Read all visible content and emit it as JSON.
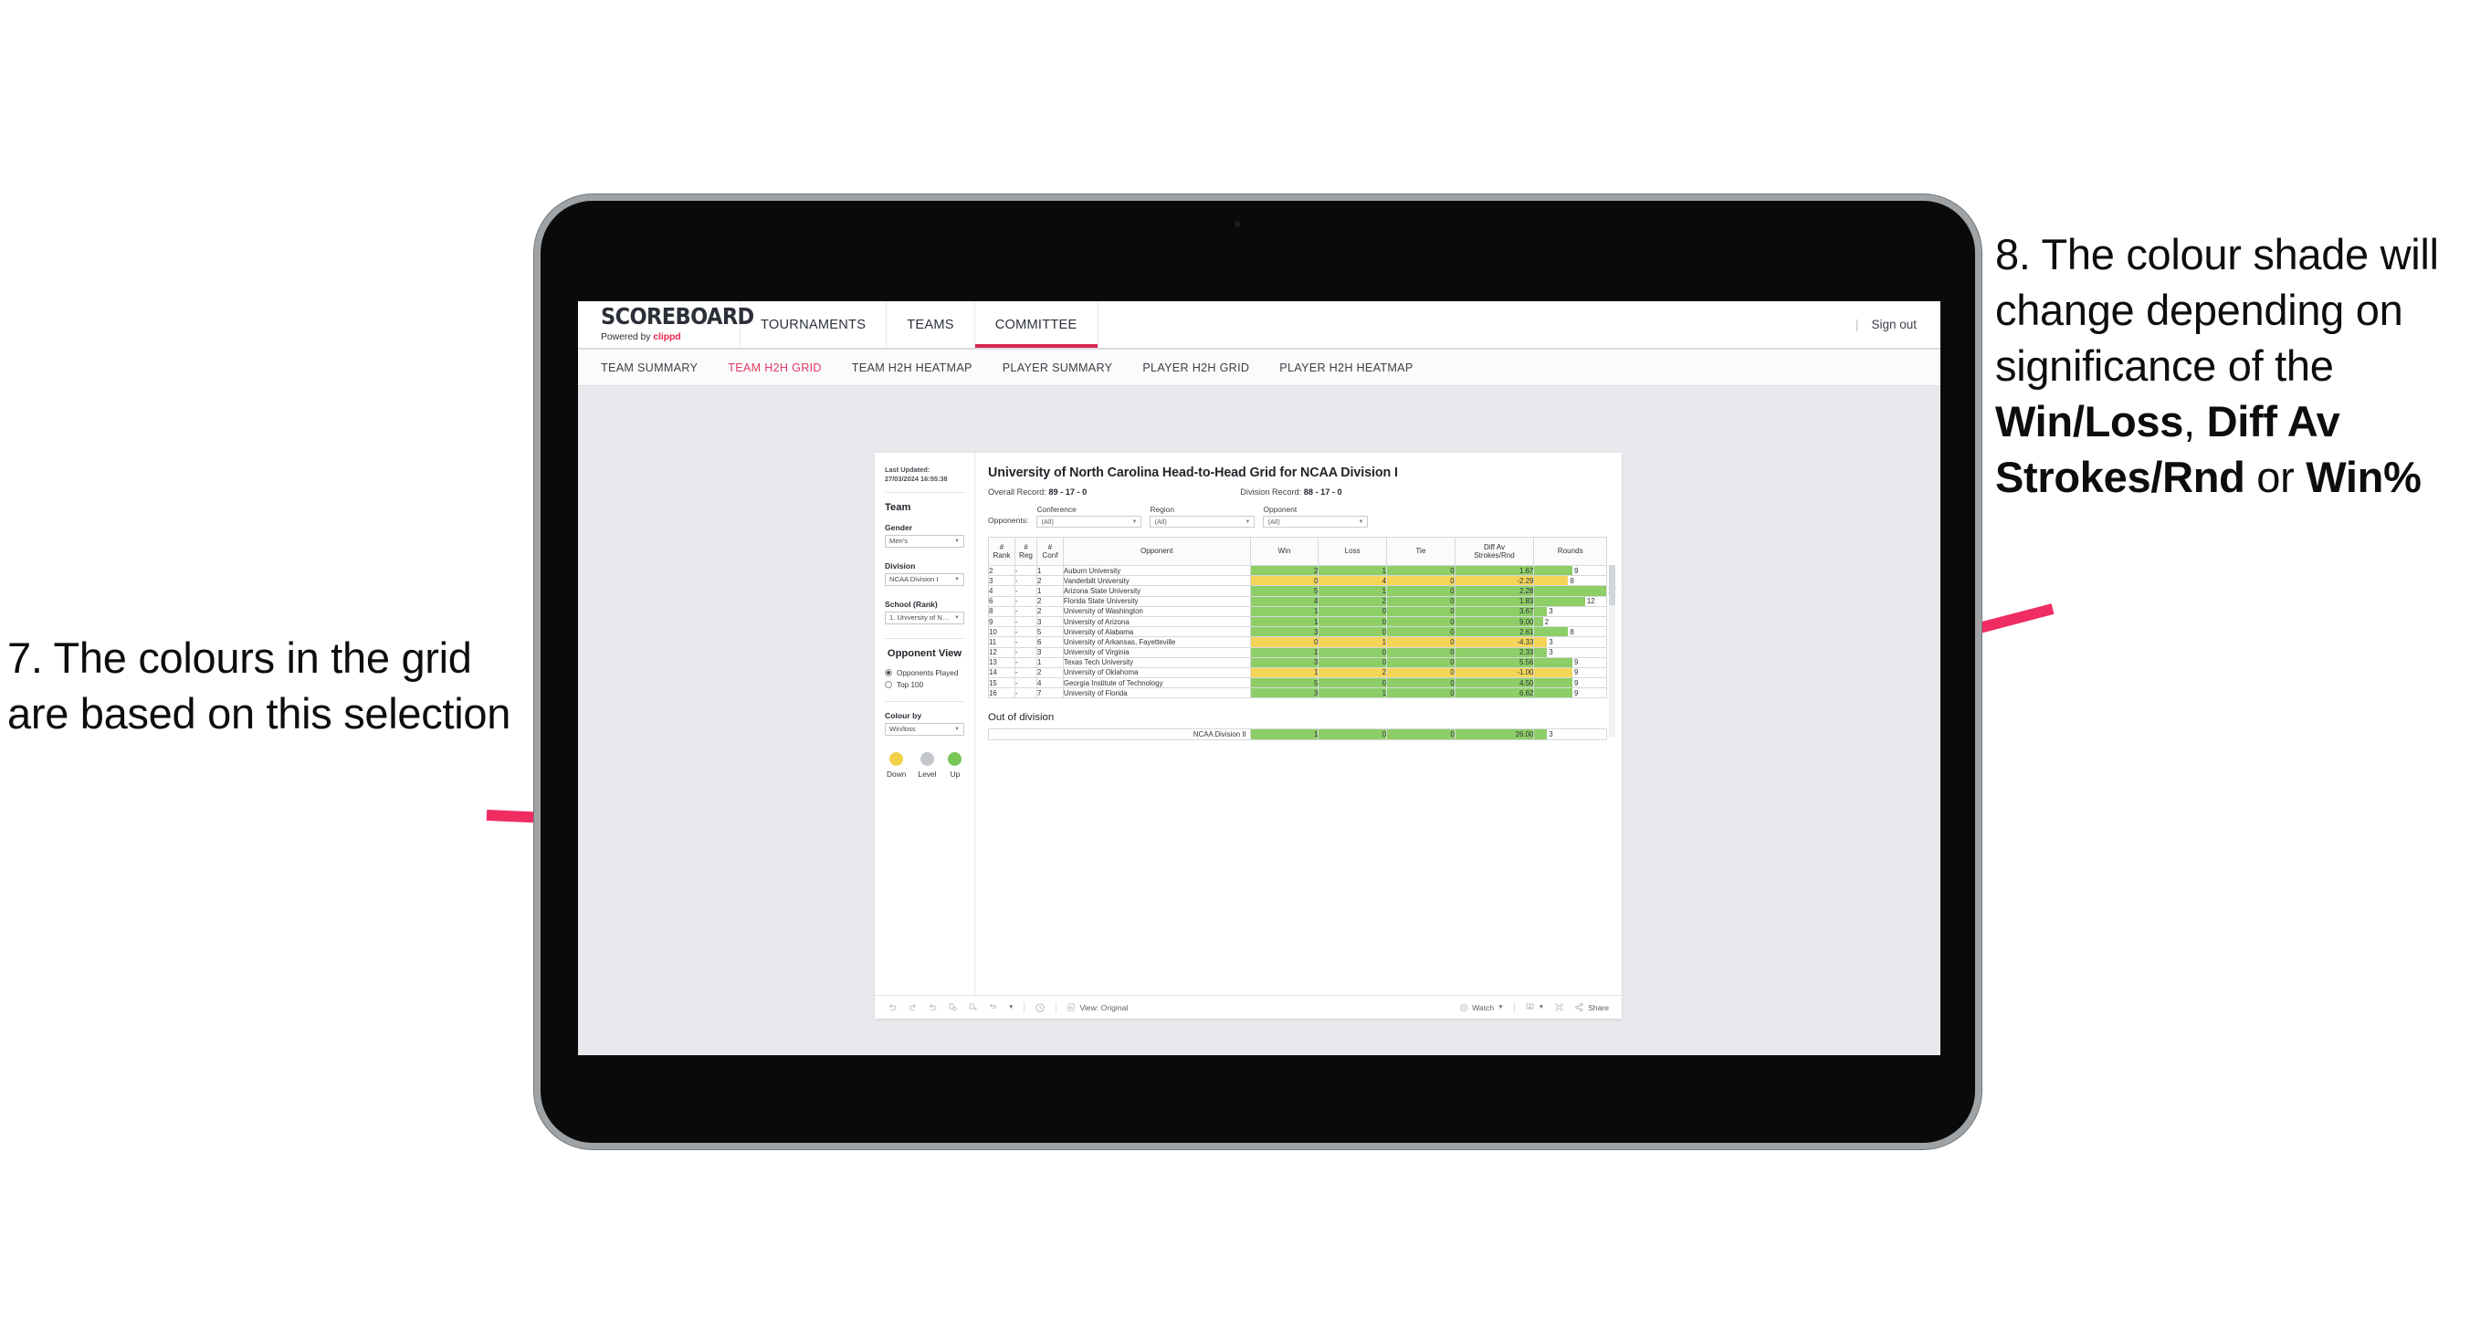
{
  "annotations": {
    "left": {
      "id": "7.",
      "text": "7. The colours in the grid are based on this selection"
    },
    "right": {
      "pre": "8. The colour shade will change depending on significance of the ",
      "b1": "Win/Loss",
      "mid1": ", ",
      "b2": "Diff Av Strokes/Rnd",
      "mid2": " or ",
      "b3": "Win%"
    },
    "arrow_color": "#ef2d62"
  },
  "app": {
    "brand": {
      "name": "SCOREBOARD",
      "powered_prefix": "Powered by ",
      "powered_brand": "clippd"
    },
    "topnav": [
      {
        "label": "TOURNAMENTS",
        "active": false
      },
      {
        "label": "TEAMS",
        "active": false
      },
      {
        "label": "COMMITTEE",
        "active": true
      }
    ],
    "signout": {
      "divider": "|",
      "label": "Sign out"
    },
    "subnav": [
      {
        "label": "TEAM SUMMARY",
        "active": false
      },
      {
        "label": "TEAM H2H GRID",
        "active": true
      },
      {
        "label": "TEAM H2H HEATMAP",
        "active": false
      },
      {
        "label": "PLAYER SUMMARY",
        "active": false
      },
      {
        "label": "PLAYER H2H GRID",
        "active": false
      },
      {
        "label": "PLAYER H2H HEATMAP",
        "active": false
      }
    ]
  },
  "panel": {
    "last_updated": "Last Updated: 27/03/2024 16:55:38",
    "team_heading": "Team",
    "gender": {
      "label": "Gender",
      "value": "Men's"
    },
    "division": {
      "label": "Division",
      "value": "NCAA Division I"
    },
    "school": {
      "label": "School (Rank)",
      "value": "1. University of Nort..."
    },
    "opponent_view": {
      "heading": "Opponent View",
      "options": [
        {
          "label": "Opponents Played",
          "selected": true
        },
        {
          "label": "Top 100",
          "selected": false
        }
      ]
    },
    "colour_by": {
      "label": "Colour by",
      "value": "Win/loss"
    },
    "legend": [
      {
        "label": "Down",
        "color": "#f2d24b"
      },
      {
        "label": "Level",
        "color": "#c3c6cb"
      },
      {
        "label": "Up",
        "color": "#77c657"
      }
    ]
  },
  "viz": {
    "title": "University of North Carolina Head-to-Head Grid for NCAA Division I",
    "overall_record": {
      "label": "Overall Record: ",
      "value": "89 - 17 - 0"
    },
    "division_record": {
      "label": "Division Record: ",
      "value": "88 - 17 - 0"
    },
    "opponents_label": "Opponents:",
    "filters": [
      {
        "label": "Conference",
        "value": "(All)"
      },
      {
        "label": "Region",
        "value": "(All)"
      },
      {
        "label": "Opponent",
        "value": "(All)"
      }
    ],
    "out_of_division_title": "Out of division"
  },
  "chart_data": {
    "type": "table",
    "title": "University of North Carolina Head-to-Head Grid for NCAA Division I",
    "columns": [
      "# Rank",
      "# Reg",
      "# Conf",
      "Opponent",
      "Win",
      "Loss",
      "Tie",
      "Diff Av Strokes/Rnd",
      "Rounds"
    ],
    "header_lines": [
      [
        "#",
        "Rank"
      ],
      [
        "#",
        "Reg"
      ],
      [
        "#",
        "Conf"
      ],
      [
        "Opponent"
      ],
      [
        "Win"
      ],
      [
        "Loss"
      ],
      [
        "Tie"
      ],
      [
        "Diff Av",
        "Strokes/Rnd"
      ],
      [
        "Rounds"
      ]
    ],
    "rounds_max": 17,
    "colors": {
      "up": "#8dce66",
      "down": "#f5d558"
    },
    "rows": [
      {
        "rank": "2",
        "reg": "-",
        "conf": "1",
        "opponent": "Auburn University",
        "win": "2",
        "loss": "1",
        "tie": "0",
        "diff": "1.67",
        "rounds": 9,
        "state": "up"
      },
      {
        "rank": "3",
        "reg": "-",
        "conf": "2",
        "opponent": "Vanderbilt University",
        "win": "0",
        "loss": "4",
        "tie": "0",
        "diff": "-2.29",
        "rounds": 8,
        "state": "down"
      },
      {
        "rank": "4",
        "reg": "-",
        "conf": "1",
        "opponent": "Arizona State University",
        "win": "5",
        "loss": "1",
        "tie": "0",
        "diff": "2.28",
        "rounds": 17,
        "state": "up"
      },
      {
        "rank": "6",
        "reg": "-",
        "conf": "2",
        "opponent": "Florida State University",
        "win": "4",
        "loss": "2",
        "tie": "0",
        "diff": "1.83",
        "rounds": 12,
        "state": "up"
      },
      {
        "rank": "8",
        "reg": "-",
        "conf": "2",
        "opponent": "University of Washington",
        "win": "1",
        "loss": "0",
        "tie": "0",
        "diff": "3.67",
        "rounds": 3,
        "state": "up"
      },
      {
        "rank": "9",
        "reg": "-",
        "conf": "3",
        "opponent": "University of Arizona",
        "win": "1",
        "loss": "0",
        "tie": "0",
        "diff": "9.00",
        "rounds": 2,
        "state": "up"
      },
      {
        "rank": "10",
        "reg": "-",
        "conf": "5",
        "opponent": "University of Alabama",
        "win": "3",
        "loss": "0",
        "tie": "0",
        "diff": "2.61",
        "rounds": 8,
        "state": "up"
      },
      {
        "rank": "11",
        "reg": "-",
        "conf": "6",
        "opponent": "University of Arkansas, Fayetteville",
        "win": "0",
        "loss": "1",
        "tie": "0",
        "diff": "-4.33",
        "rounds": 3,
        "state": "down"
      },
      {
        "rank": "12",
        "reg": "-",
        "conf": "3",
        "opponent": "University of Virginia",
        "win": "1",
        "loss": "0",
        "tie": "0",
        "diff": "2.33",
        "rounds": 3,
        "state": "up"
      },
      {
        "rank": "13",
        "reg": "-",
        "conf": "1",
        "opponent": "Texas Tech University",
        "win": "3",
        "loss": "0",
        "tie": "0",
        "diff": "5.56",
        "rounds": 9,
        "state": "up"
      },
      {
        "rank": "14",
        "reg": "-",
        "conf": "2",
        "opponent": "University of Oklahoma",
        "win": "1",
        "loss": "2",
        "tie": "0",
        "diff": "-1.00",
        "rounds": 9,
        "state": "down"
      },
      {
        "rank": "15",
        "reg": "-",
        "conf": "4",
        "opponent": "Georgia Institute of Technology",
        "win": "5",
        "loss": "0",
        "tie": "0",
        "diff": "4.50",
        "rounds": 9,
        "state": "up"
      },
      {
        "rank": "16",
        "reg": "-",
        "conf": "7",
        "opponent": "University of Florida",
        "win": "3",
        "loss": "1",
        "tie": "0",
        "diff": "6.62",
        "rounds": 9,
        "state": "up"
      }
    ],
    "out_of_division": [
      {
        "opponent": "NCAA Division II",
        "win": "1",
        "loss": "0",
        "tie": "0",
        "diff": "26.00",
        "rounds": 3,
        "state": "up"
      }
    ]
  },
  "toolbar": {
    "view_label": "View: Original",
    "watch_label": "Watch",
    "share_label": "Share",
    "icons": [
      "undo-icon",
      "redo-icon",
      "revert-icon",
      "refresh-data-icon",
      "pause-icon",
      "alerts-icon",
      "dropdown-caret",
      "clock-icon",
      "view-icon",
      "watch-icon",
      "download-icon",
      "fullscreen-icon",
      "share-icon"
    ]
  }
}
